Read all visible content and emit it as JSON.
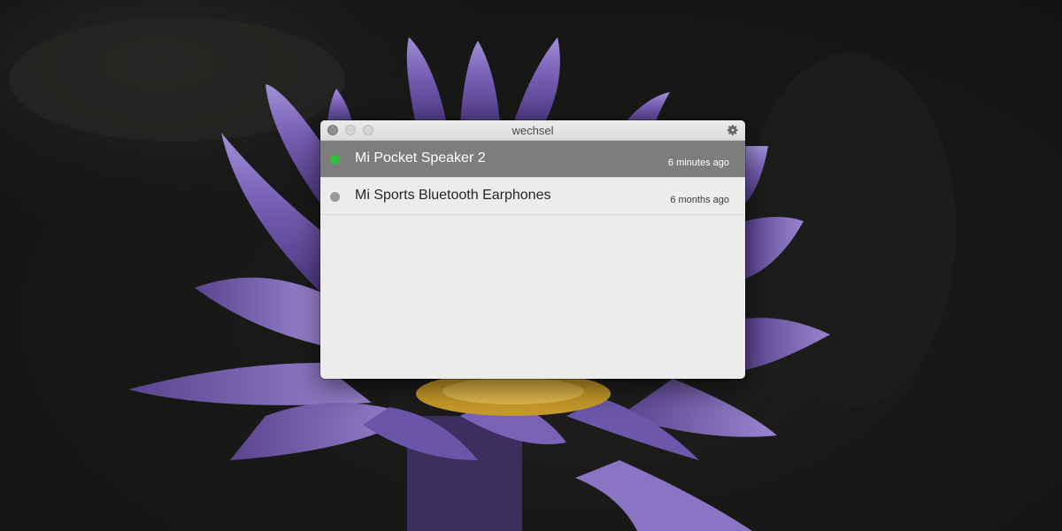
{
  "window": {
    "title": "wechsel",
    "settings_icon": "gear-icon"
  },
  "devices": [
    {
      "name": "Mi Pocket Speaker 2",
      "last_connected": "6 minutes ago",
      "status": "connected",
      "status_color": "#2fbf3a",
      "selected": true
    },
    {
      "name": "Mi Sports Bluetooth Earphones",
      "last_connected": "6 months ago",
      "status": "disconnected",
      "status_color": "#9a9a9a",
      "selected": false
    }
  ],
  "colors": {
    "selected_row": "#7d7d7d",
    "window_bg": "#ececec",
    "wallpaper_flower": "#8a6fc4"
  }
}
